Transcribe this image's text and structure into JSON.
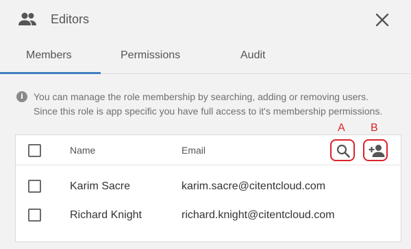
{
  "dialog": {
    "title": "Editors",
    "title_icon": "people-icon",
    "close_icon": "close-icon"
  },
  "tabs": [
    {
      "label": "Members",
      "active": true
    },
    {
      "label": "Permissions",
      "active": false
    },
    {
      "label": "Audit",
      "active": false
    }
  ],
  "info": {
    "icon": "info-icon",
    "line1": "You can manage the role membership by searching, adding or removing users.",
    "line2": "Since this role is app specific you have full access to it's membership permissions."
  },
  "callouts": {
    "a": "A",
    "b": "B"
  },
  "table": {
    "columns": [
      "Name",
      "Email"
    ],
    "actions": [
      {
        "icon": "search-icon",
        "callout": "A"
      },
      {
        "icon": "add-person-icon",
        "callout": "B"
      }
    ],
    "rows": [
      {
        "name": "Karim Sacre",
        "email": "karim.sacre@citentcloud.com",
        "checked": false
      },
      {
        "name": "Richard Knight",
        "email": "richard.knight@citentcloud.com",
        "checked": false
      }
    ]
  },
  "colors": {
    "accent": "#3f7fbf",
    "callout": "#d9232a",
    "background": "#f2f2f2"
  }
}
